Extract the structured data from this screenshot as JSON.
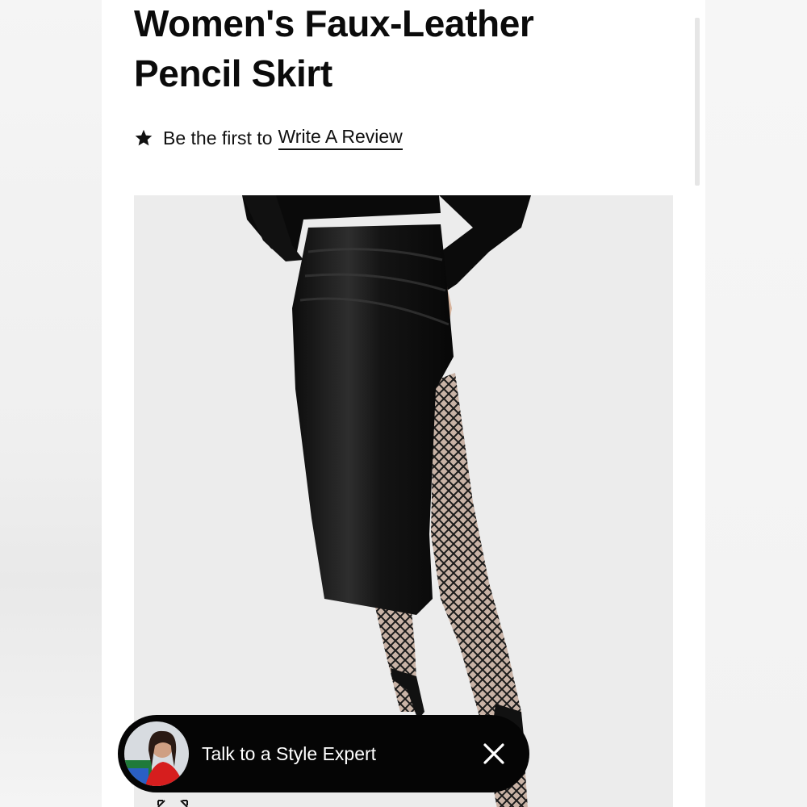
{
  "product": {
    "title": "Women's Faux-Leather Pencil Skirt"
  },
  "reviews": {
    "star_icon": "star-icon",
    "prompt": "Be the first to",
    "link_label": "Write A Review"
  },
  "image": {
    "subject": "product-photo"
  },
  "chat_widget": {
    "label": "Talk to a Style Expert",
    "avatar_icon": "avatar",
    "close_icon": "close-icon",
    "expand_icon": "expand-icon"
  },
  "colors": {
    "page_background": "#ffffff",
    "chat_background": "#050505",
    "text": "#111111"
  }
}
